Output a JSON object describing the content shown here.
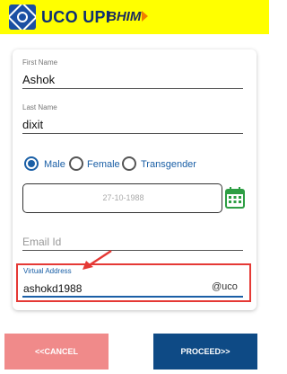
{
  "header": {
    "brand": "UCO UPI",
    "bhim": "BHIM",
    "colors": {
      "background": "#ffff00",
      "brand_text": "#0d2f73",
      "logo": "#1a4fa3"
    }
  },
  "form": {
    "first_name": {
      "label": "First Name",
      "value": "Ashok"
    },
    "last_name": {
      "label": "Last Name",
      "value": "dixit"
    },
    "gender": {
      "options": [
        "Male",
        "Female",
        "Transgender"
      ],
      "selected": "Male"
    },
    "dob": {
      "value": "27-10-1988",
      "icon": "calendar-icon"
    },
    "email": {
      "placeholder": "Email Id",
      "value": ""
    },
    "virtual_address": {
      "label": "Virtual Address",
      "value": "ashokd1988",
      "suffix": "@uco"
    }
  },
  "buttons": {
    "cancel": "<<CANCEL",
    "proceed": "PROCEED>>"
  },
  "colors": {
    "accent": "#1a5fa6",
    "highlight": "#e53935",
    "cancel": "#f08a8a",
    "proceed": "#0e4a85"
  }
}
